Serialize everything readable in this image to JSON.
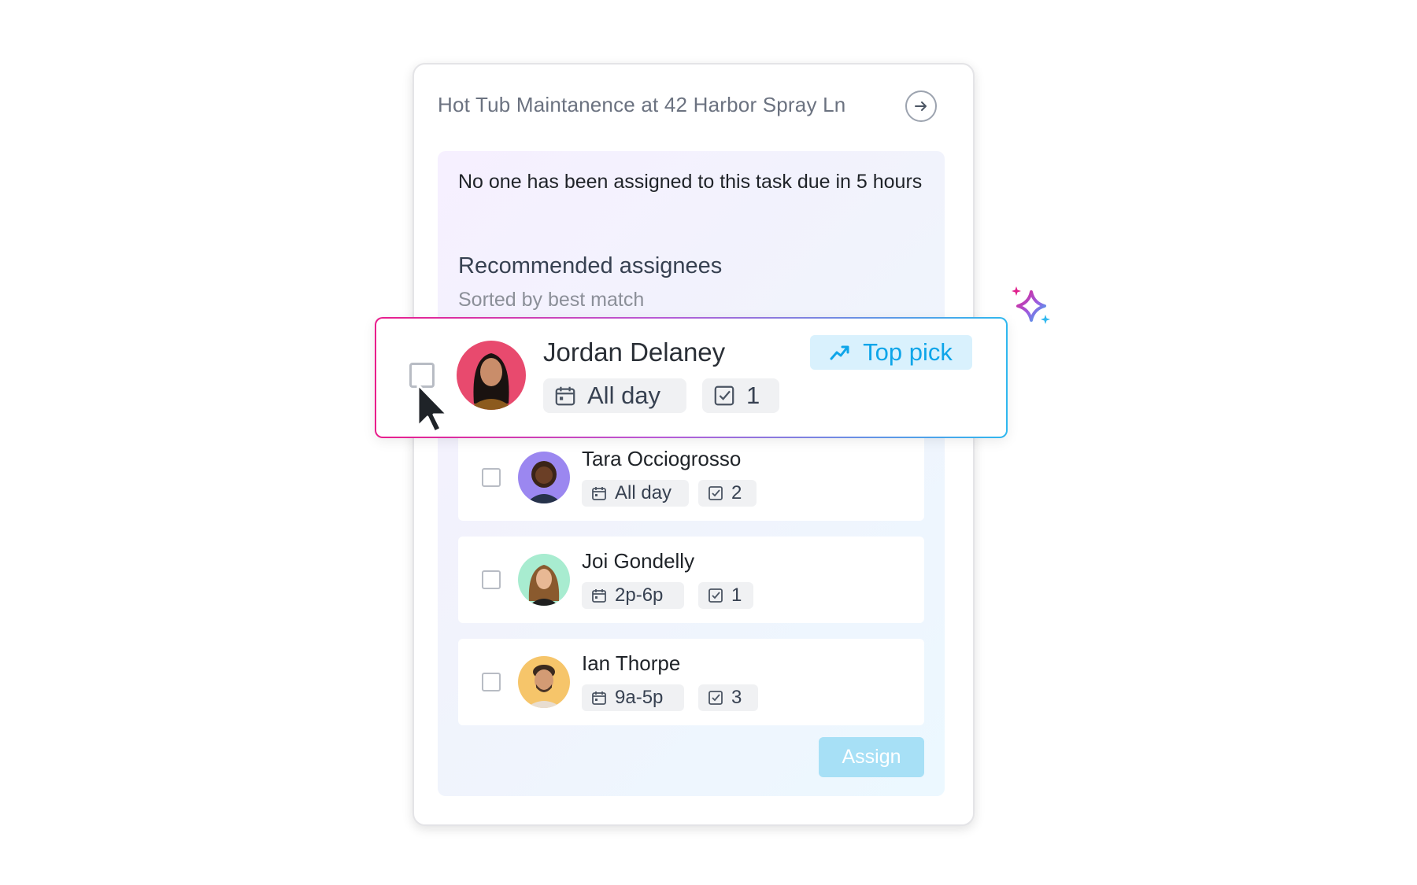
{
  "task": {
    "title": "Hot Tub Maintanence at 42 Harbor Spray Ln"
  },
  "notice": {
    "text": "No one has been assigned to this task due in 5 hours"
  },
  "recommendations": {
    "title": "Recommended assignees",
    "subtitle": "Sorted by best match"
  },
  "top_pick": {
    "name": "Jordan Delaney",
    "availability": "All day",
    "task_count": "1",
    "badge_label": "Top pick",
    "avatar_color": "#e84a6e"
  },
  "assignees": [
    {
      "name": "Tara Occiogrosso",
      "availability": "All day",
      "task_count": "2",
      "avatar_color": "#9b87f0"
    },
    {
      "name": "Joi Gondelly",
      "availability": "2p-6p",
      "task_count": "1",
      "avatar_color": "#a8ecd0"
    },
    {
      "name": "Ian Thorpe",
      "availability": "9a-5p",
      "task_count": "3",
      "avatar_color": "#f6c56a"
    }
  ],
  "actions": {
    "assign_label": "Assign"
  },
  "colors": {
    "accent": "#0ea5e9",
    "assign_disabled": "#a7e0f6",
    "highlight_gradient": [
      "#e91e8c",
      "#b85ad6",
      "#2fb8ef"
    ]
  },
  "icons": [
    "arrow-right-icon",
    "calendar-icon",
    "task-check-icon",
    "trending-up-icon",
    "cursor-icon",
    "sparkle-icon"
  ]
}
